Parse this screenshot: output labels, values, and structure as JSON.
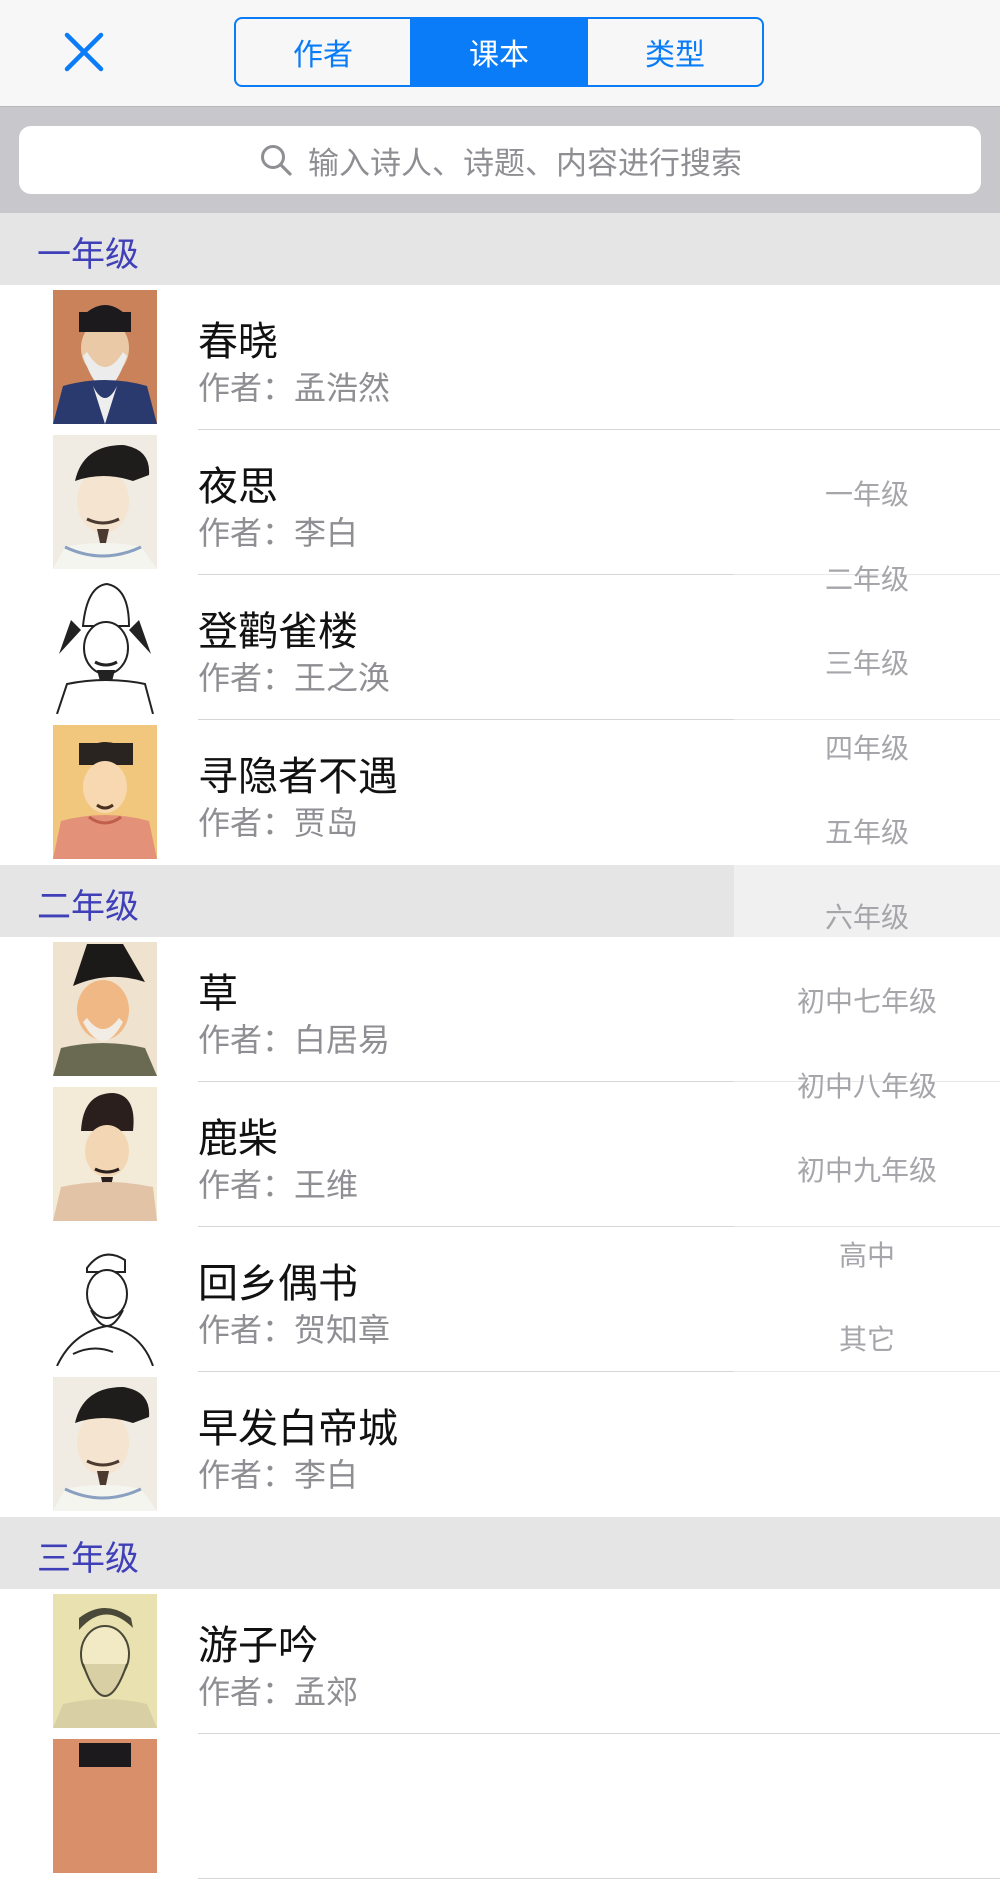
{
  "header": {
    "tabs": [
      {
        "label": "作者",
        "active": false
      },
      {
        "label": "课本",
        "active": true
      },
      {
        "label": "类型",
        "active": false
      }
    ],
    "close_icon": "close-icon"
  },
  "search": {
    "placeholder": "输入诗人、诗题、内容进行搜索",
    "icon": "search-icon"
  },
  "sections": [
    {
      "title": "一年级",
      "rows": [
        {
          "title": "春晓",
          "author_label": "作者：",
          "author": "孟浩然"
        },
        {
          "title": "夜思",
          "author_label": "作者：",
          "author": "李白"
        },
        {
          "title": "登鹳雀楼",
          "author_label": "作者：",
          "author": "王之涣"
        },
        {
          "title": "寻隐者不遇",
          "author_label": "作者：",
          "author": "贾岛"
        }
      ]
    },
    {
      "title": "二年级",
      "rows": [
        {
          "title": "草",
          "author_label": "作者：",
          "author": "白居易"
        },
        {
          "title": "鹿柴",
          "author_label": "作者：",
          "author": "王维"
        },
        {
          "title": "回乡偶书",
          "author_label": "作者：",
          "author": "贺知章"
        },
        {
          "title": "早发白帝城",
          "author_label": "作者：",
          "author": "李白"
        }
      ]
    },
    {
      "title": "三年级",
      "rows": [
        {
          "title": "游子吟",
          "author_label": "作者：",
          "author": "孟郊"
        }
      ]
    }
  ],
  "index": [
    "一年级",
    "二年级",
    "三年级",
    "四年级",
    "五年级",
    "六年级",
    "初中七年级",
    "初中八年级",
    "初中九年级",
    "高中",
    "其它"
  ],
  "colors": {
    "accent": "#0a7cf7",
    "section_title": "#3f3fb8",
    "section_bg": "#e5e5e6"
  }
}
